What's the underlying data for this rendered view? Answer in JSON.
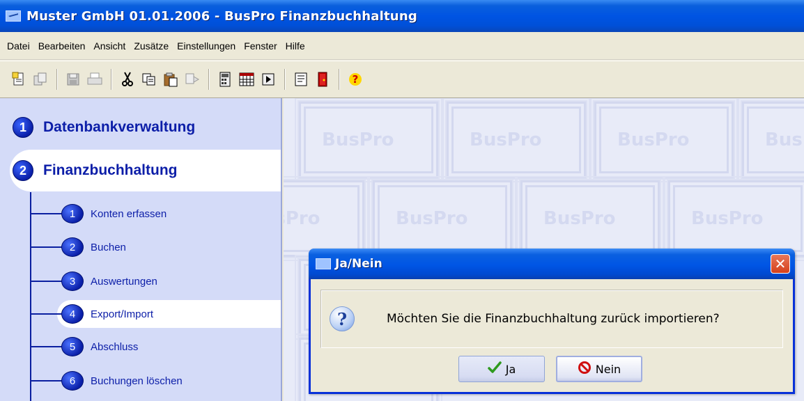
{
  "window": {
    "title": "Muster GmbH 01.01.2006 - BusPro Finanzbuchhaltung"
  },
  "menubar": {
    "items": [
      "Datei",
      "Bearbeiten",
      "Ansicht",
      "Zusätze",
      "Einstellungen",
      "Fenster",
      "Hilfe"
    ]
  },
  "toolbar": {
    "icons": [
      "new-document-icon",
      "copy-document-icon",
      "save-icon",
      "print-icon",
      "cut-icon",
      "copy-icon",
      "paste-icon",
      "paste-special-icon",
      "calculator-icon",
      "calendar-icon",
      "play-icon",
      "report-icon",
      "exit-door-icon",
      "help-icon"
    ]
  },
  "sidebar": {
    "sections": [
      {
        "number": "1",
        "label": "Datenbankverwaltung"
      },
      {
        "number": "2",
        "label": "Finanzbuchhaltung"
      }
    ],
    "sub_items": [
      {
        "number": "1",
        "label": "Konten erfassen"
      },
      {
        "number": "2",
        "label": "Buchen"
      },
      {
        "number": "3",
        "label": "Auswertungen"
      },
      {
        "number": "4",
        "label": "Export/Import"
      },
      {
        "number": "5",
        "label": "Abschluss"
      },
      {
        "number": "6",
        "label": "Buchungen löschen"
      }
    ]
  },
  "workspace": {
    "watermark": "BusPro"
  },
  "dialog": {
    "title": "Ja/Nein",
    "close_glyph": "✕",
    "message": "Möchten Sie die Finanzbuchhaltung zurück importieren?",
    "yes_label": "Ja",
    "no_label": "Nein"
  }
}
